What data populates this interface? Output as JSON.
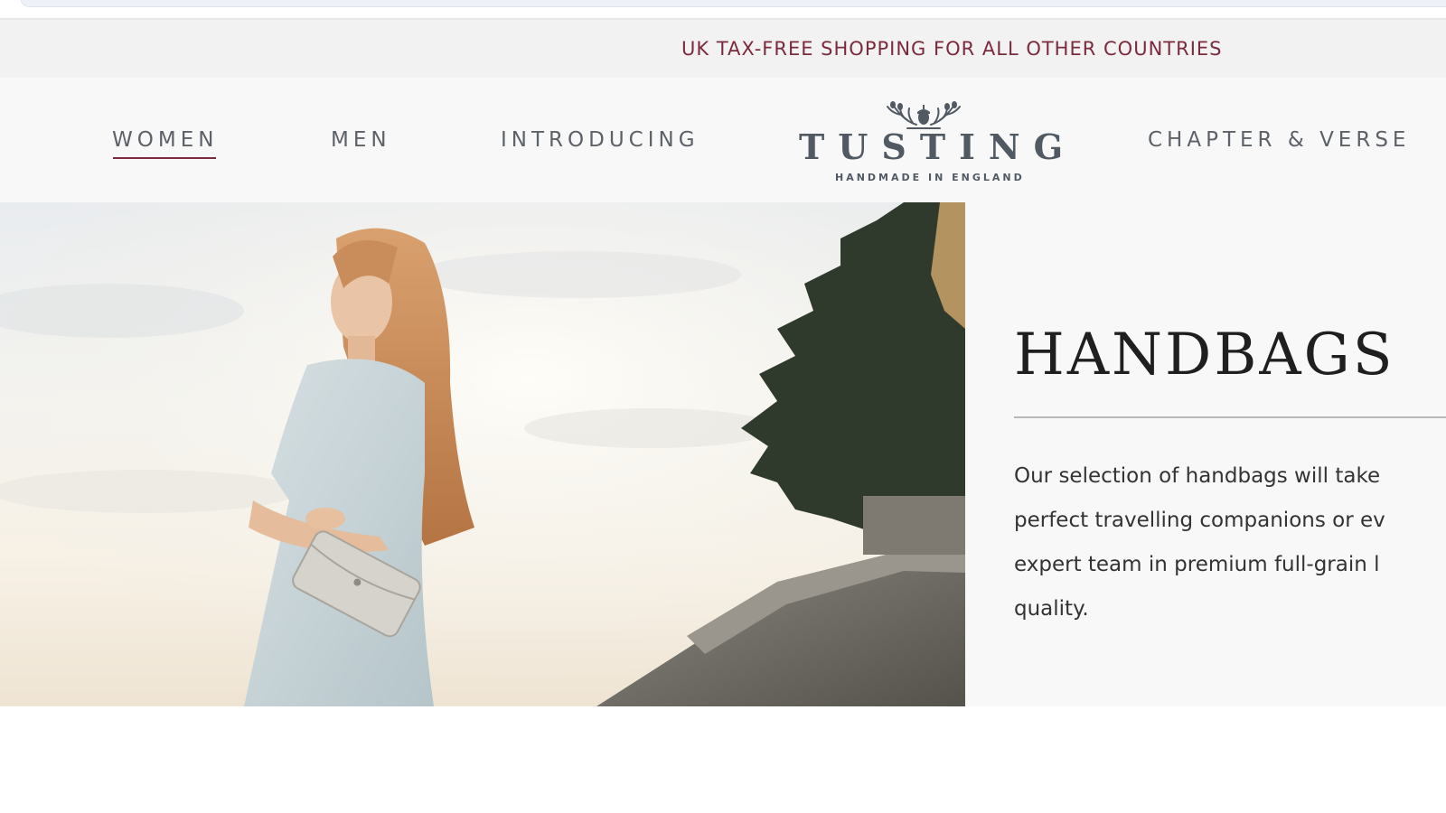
{
  "browser": {
    "tab_strip": ""
  },
  "promo_banner": {
    "text": "UK TAX-FREE SHOPPING FOR ALL OTHER COUNTRIES",
    "color": "#7c2a3e"
  },
  "nav": {
    "items": [
      {
        "label": "WOMEN",
        "active": true
      },
      {
        "label": "MEN",
        "active": false
      },
      {
        "label": "INTRODUCING",
        "active": false
      },
      {
        "label": "CHAPTER & VERSE",
        "active": false
      }
    ],
    "active_underline_color": "#7c2a3e"
  },
  "logo": {
    "wordmark": "TUSTING",
    "tagline": "HANDMADE IN ENGLAND",
    "icon": "crown-crest-icon"
  },
  "hero": {
    "image": "model-with-silver-clutch-photo"
  },
  "category": {
    "title": "HANDBAGS",
    "description_lines": [
      "Our selection of handbags will take",
      "perfect travelling companions or ev",
      "expert team in premium full-grain l",
      "quality."
    ]
  }
}
